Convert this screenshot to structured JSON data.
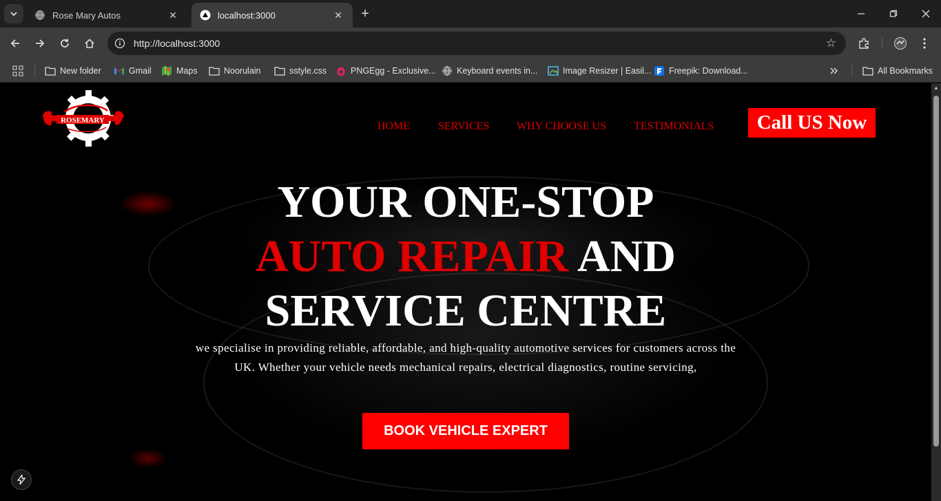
{
  "browser": {
    "tabs": [
      {
        "title": "Rose Mary Autos",
        "icon": "globe-icon",
        "active": false
      },
      {
        "title": "localhost:3000",
        "icon": "nextjs-triangle-icon",
        "active": true
      }
    ],
    "url": "http://localhost:3000",
    "bookmarks": [
      {
        "label": "New folder",
        "icon": "folder-icon"
      },
      {
        "label": "Gmail",
        "icon": "gmail-icon"
      },
      {
        "label": "Maps",
        "icon": "maps-icon"
      },
      {
        "label": "Noorulain",
        "icon": "folder-icon"
      },
      {
        "label": "sstyle.css",
        "icon": "folder-icon"
      },
      {
        "label": "PNGEgg - Exclusive...",
        "icon": "pngegg-icon"
      },
      {
        "label": "Keyboard events in...",
        "icon": "globe-icon"
      },
      {
        "label": "Image Resizer | Easil...",
        "icon": "image-icon"
      },
      {
        "label": "Freepik: Download...",
        "icon": "freepik-icon"
      }
    ],
    "all_bookmarks": "All Bookmarks"
  },
  "page": {
    "logo_text": "ROSEMARY",
    "nav": [
      "HOME",
      "SERVICES",
      "WHY CHOOSE US",
      "TESTIMONIALS"
    ],
    "call_button": "Call US Now",
    "hero": {
      "line1": "YOUR ONE-STOP",
      "line2_red": "AUTO REPAIR",
      "line2_white": "AND",
      "line3": "SERVICE CENTRE",
      "description": "we specialise in providing reliable, affordable, and high-quality automotive services for customers across the UK. Whether your vehicle needs mechanical repairs, electrical diagnostics, routine servicing,"
    },
    "book_button": "BOOK VEHICLE EXPERT"
  },
  "colors": {
    "accent": "#ff0000",
    "nav_red": "#e00000",
    "background": "#000000",
    "text": "#ffffff"
  }
}
